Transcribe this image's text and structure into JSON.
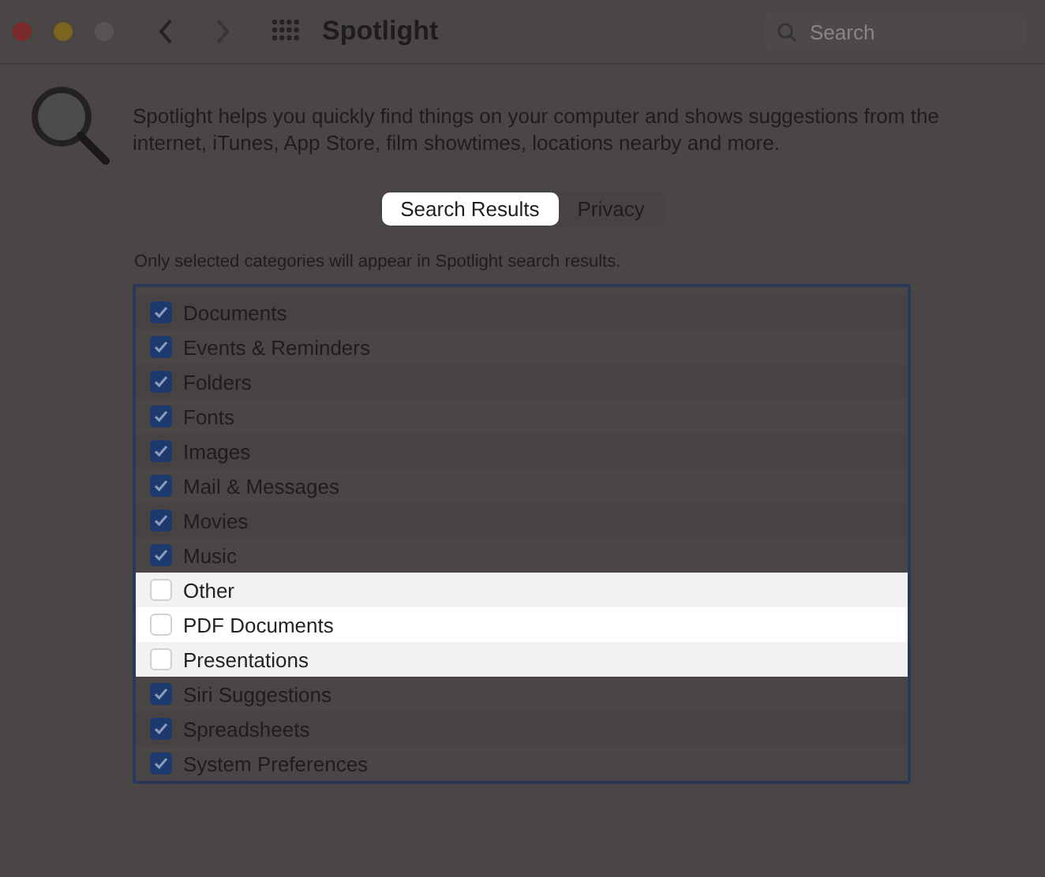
{
  "window": {
    "title": "Spotlight"
  },
  "search": {
    "placeholder": "Search"
  },
  "description": "Spotlight helps you quickly find things on your computer and shows suggestions from the internet, iTunes, App Store, film showtimes, locations nearby and more.",
  "tabs": [
    {
      "label": "Search Results",
      "selected": true
    },
    {
      "label": "Privacy",
      "selected": false
    }
  ],
  "note": "Only selected categories will appear in Spotlight search results.",
  "categories": [
    {
      "label": "Documents",
      "checked": true,
      "highlighted": false
    },
    {
      "label": "Events & Reminders",
      "checked": true,
      "highlighted": false
    },
    {
      "label": "Folders",
      "checked": true,
      "highlighted": false
    },
    {
      "label": "Fonts",
      "checked": true,
      "highlighted": false
    },
    {
      "label": "Images",
      "checked": true,
      "highlighted": false
    },
    {
      "label": "Mail & Messages",
      "checked": true,
      "highlighted": false
    },
    {
      "label": "Movies",
      "checked": true,
      "highlighted": false
    },
    {
      "label": "Music",
      "checked": true,
      "highlighted": false
    },
    {
      "label": "Other",
      "checked": false,
      "highlighted": true
    },
    {
      "label": "PDF Documents",
      "checked": false,
      "highlighted": true
    },
    {
      "label": "Presentations",
      "checked": false,
      "highlighted": true
    },
    {
      "label": "Siri Suggestions",
      "checked": true,
      "highlighted": false
    },
    {
      "label": "Spreadsheets",
      "checked": true,
      "highlighted": false
    },
    {
      "label": "System Preferences",
      "checked": true,
      "highlighted": false
    }
  ]
}
